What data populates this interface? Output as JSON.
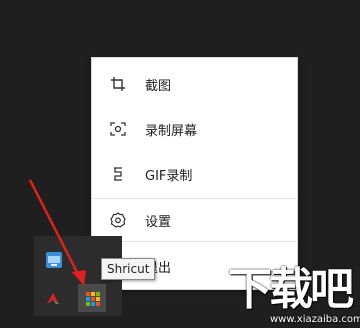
{
  "menu": {
    "items": [
      {
        "label": "截图",
        "icon": "crop-icon"
      },
      {
        "label": "录制屏幕",
        "icon": "screen-record-icon"
      },
      {
        "label": "GIF录制",
        "icon": "gif-record-icon"
      },
      {
        "label": "设置",
        "icon": "gear-icon"
      },
      {
        "label": "退出",
        "icon": "exit-icon"
      }
    ]
  },
  "tooltip": {
    "text": "Shricut"
  },
  "tray": {
    "icons": [
      "network-icon",
      "red-arrow-app-icon",
      "shricut-tray-icon"
    ]
  },
  "watermark": {
    "main": "下载吧",
    "url": "www.xiazaiba.com"
  },
  "colors": {
    "menu_bg": "#ffffff",
    "desktop_bg": "#1f1f1f",
    "arrow": "#e0201b"
  }
}
